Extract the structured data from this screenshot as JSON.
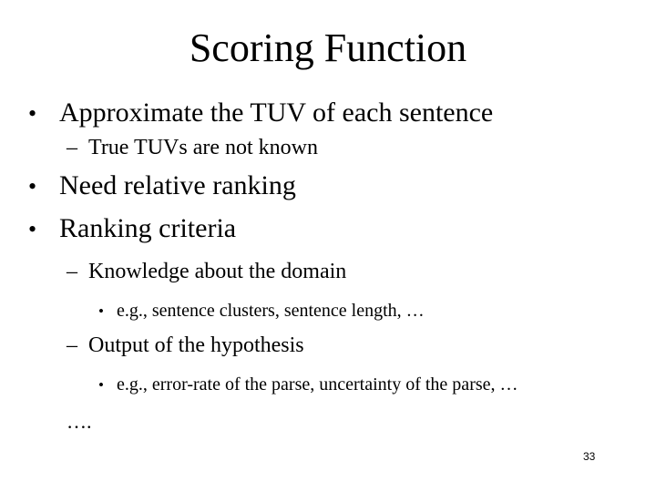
{
  "slide": {
    "title": "Scoring Function",
    "bullet_glyph": "•",
    "dash_glyph": "–",
    "items": [
      {
        "text": "Approximate the TUV of each sentence"
      },
      {
        "text": "True TUVs are not known"
      },
      {
        "text": "Need relative ranking"
      },
      {
        "text": "Ranking criteria"
      },
      {
        "text": "Knowledge about the domain"
      },
      {
        "text": "e.g., sentence clusters, sentence length, …"
      },
      {
        "text": "Output of the hypothesis"
      },
      {
        "text": "e.g., error-rate of the parse, uncertainty of the parse, …"
      }
    ],
    "trailing": "….",
    "page_number": "33"
  }
}
